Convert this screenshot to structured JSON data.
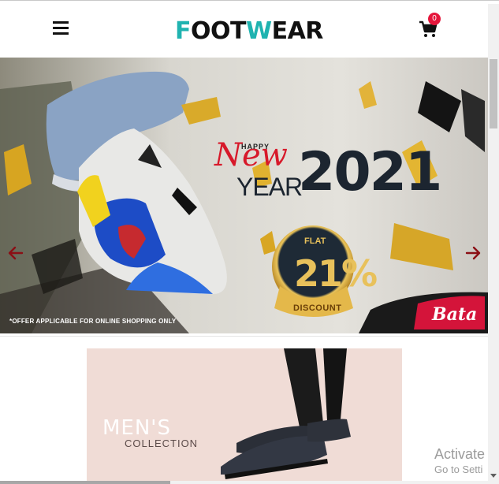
{
  "header": {
    "logo_part1": "F",
    "logo_part2": "OOT",
    "logo_part3": "W",
    "logo_part4": "EAR",
    "cart_count": "0",
    "accent_color": "#1fb3b0",
    "badge_color": "#e5173c"
  },
  "banner": {
    "happy": "HAPPY",
    "new": "New",
    "year": "YEAR",
    "year_number": "2021",
    "flat": "FLAT",
    "percent": "21%",
    "discount": "DISCOUNT",
    "offer_note": "*OFFER APPLICABLE FOR ONLINE SHOPPING ONLY",
    "brand": "Bata",
    "prev_icon": "arrow-left-icon",
    "next_icon": "arrow-right-icon"
  },
  "mens": {
    "title": "MEN'S",
    "subtitle": "COLLECTION"
  },
  "watermark": {
    "line1": "Activate W",
    "line2": "Go to Setti"
  }
}
